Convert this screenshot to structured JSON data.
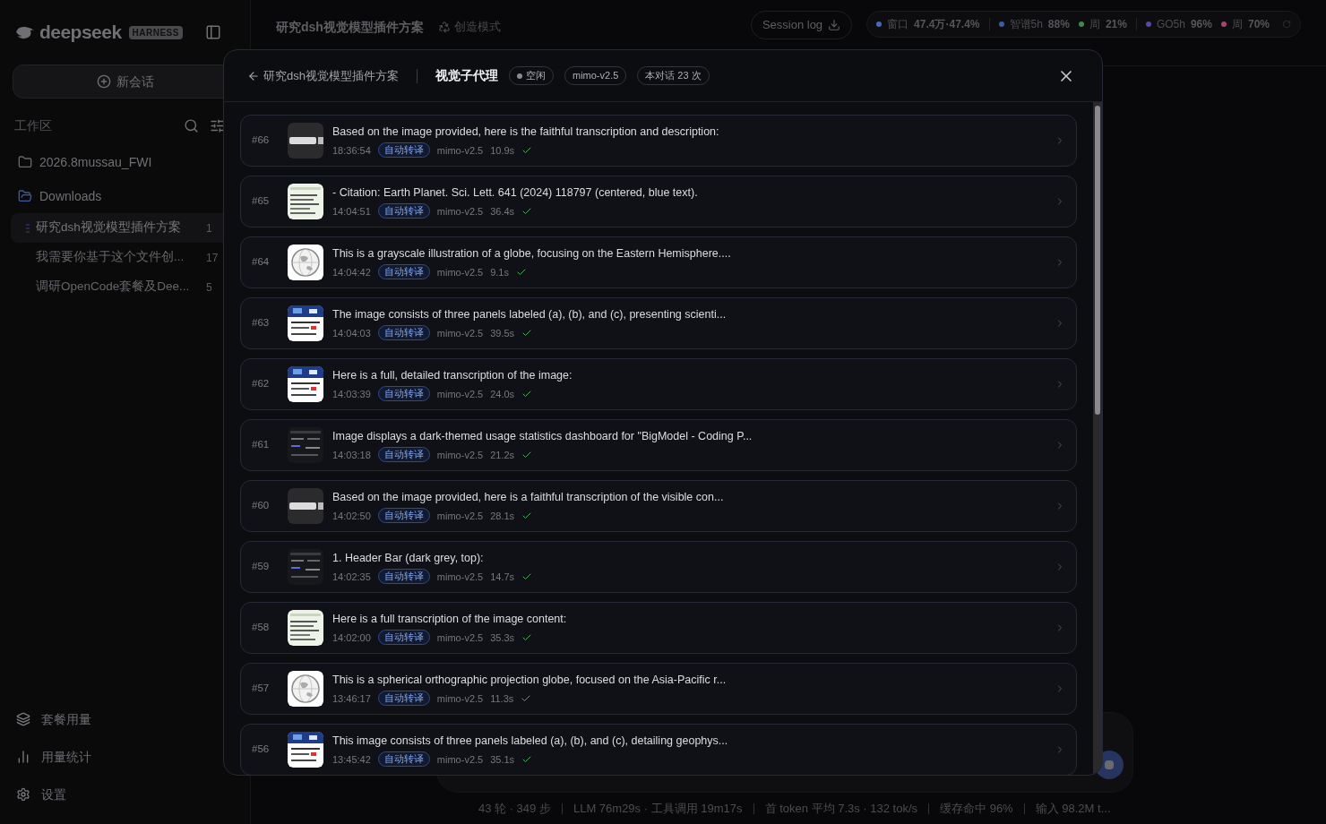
{
  "sidebar": {
    "logo": "deepseek",
    "badge": "HARNESS",
    "new_chat": "新会话",
    "workspace_label": "工作区",
    "folders": [
      {
        "name": "2026.8mussau_FWI",
        "expanded": false
      },
      {
        "name": "Downloads",
        "expanded": true,
        "children": [
          {
            "title": "研究dsh视觉模型插件方案",
            "time": "1",
            "selected": true
          },
          {
            "title": "我需要你基于这个文件创...",
            "time": "17",
            "selected": false
          },
          {
            "title": "调研OpenCode套餐及Dee...",
            "time": "5",
            "selected": false
          }
        ]
      }
    ],
    "footer": [
      {
        "kind": "plan",
        "label": "套餐用量"
      },
      {
        "kind": "stats",
        "label": "用量统计"
      },
      {
        "kind": "settings",
        "label": "设置"
      }
    ]
  },
  "header": {
    "title": "研究dsh视觉模型插件方案",
    "mode": "创造模式",
    "session_log": "Session log",
    "usage_groups": [
      {
        "items": [
          {
            "label": "窗口",
            "value": "47.4万·47.4%",
            "color": "#4a67b8"
          }
        ]
      },
      {
        "items": [
          {
            "label": "智谱5h",
            "value": "88%",
            "color": "#3f5aa8"
          },
          {
            "label": "周",
            "value": "21%",
            "color": "#3e8a4a"
          }
        ]
      },
      {
        "items": [
          {
            "label": "GO5h",
            "value": "96%",
            "color": "#5b45a8"
          },
          {
            "label": "周",
            "value": "70%",
            "color": "#a8456e"
          }
        ]
      }
    ]
  },
  "status_bar": [
    "43 轮 · 349 步",
    "LLM 76m29s · 工具调用 19m17s",
    "首 token 平均 7.3s · 132 tok/s",
    "缓存命中 96%",
    "输入 98.2M t..."
  ],
  "dialog": {
    "back": "研究dsh视觉模型插件方案",
    "title": "视觉子代理",
    "status": "空闲",
    "model": "mimo-v2.5",
    "count": "本对话 23 次",
    "rows": [
      {
        "id": "#66",
        "text": "Based on the image provided, here is the faithful transcription and description:",
        "time": "18:36:54",
        "tag": "自动转译",
        "model": "mimo-v2.5",
        "duration": "10.9s",
        "success": true
      },
      {
        "id": "#65",
        "text": "- Citation: Earth Planet. Sci. Lett. 641 (2024) 118797 (centered, blue text).",
        "time": "14:04:51",
        "tag": "自动转译",
        "model": "mimo-v2.5",
        "duration": "36.4s",
        "success": true
      },
      {
        "id": "#64",
        "text": "This is a grayscale illustration of a globe, focusing on the Eastern Hemisphere....",
        "time": "14:04:42",
        "tag": "自动转译",
        "model": "mimo-v2.5",
        "duration": "9.1s",
        "success": true
      },
      {
        "id": "#63",
        "text": "The image consists of three panels labeled (a), (b), and (c), presenting scienti...",
        "time": "14:04:03",
        "tag": "自动转译",
        "model": "mimo-v2.5",
        "duration": "39.5s",
        "success": true
      },
      {
        "id": "#62",
        "text": "Here is a full, detailed transcription of the image:",
        "time": "14:03:39",
        "tag": "自动转译",
        "model": "mimo-v2.5",
        "duration": "24.0s",
        "success": true
      },
      {
        "id": "#61",
        "text": "Image displays a dark-themed usage statistics dashboard for \"BigModel - Coding P...",
        "time": "14:03:18",
        "tag": "自动转译",
        "model": "mimo-v2.5",
        "duration": "21.2s",
        "success": true
      },
      {
        "id": "#60",
        "text": "Based on the image provided, here is a faithful transcription of the visible con...",
        "time": "14:02:50",
        "tag": "自动转译",
        "model": "mimo-v2.5",
        "duration": "28.1s",
        "success": true
      },
      {
        "id": "#59",
        "text": "1. Header Bar (dark grey, top):",
        "time": "14:02:35",
        "tag": "自动转译",
        "model": "mimo-v2.5",
        "duration": "14.7s",
        "success": true
      },
      {
        "id": "#58",
        "text": "Here is a full transcription of the image content:",
        "time": "14:02:00",
        "tag": "自动转译",
        "model": "mimo-v2.5",
        "duration": "35.3s",
        "success": true
      },
      {
        "id": "#57",
        "text": "This is a spherical orthographic projection globe, focused on the Asia-Pacific r...",
        "time": "13:46:17",
        "tag": "自动转译",
        "model": "mimo-v2.5",
        "duration": "11.3s",
        "success": true
      },
      {
        "id": "#56",
        "text": "This image consists of three panels labeled (a), (b), and (c), detailing geophys...",
        "time": "13:45:42",
        "tag": "自动转译",
        "model": "mimo-v2.5",
        "duration": "35.1s",
        "success": true
      }
    ]
  }
}
